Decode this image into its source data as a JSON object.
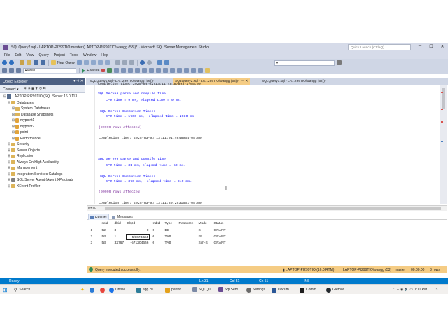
{
  "window": {
    "title": "SQLQuery2.sql - LAPTOP-PI299TIO.master (LAPTOP-PI299TIO\\wangg (53))* - Microsoft SQL Server Management Studio",
    "quick_launch_placeholder": "Quick Launch (Ctrl+Q)"
  },
  "menu": [
    "File",
    "Edit",
    "View",
    "Query",
    "Project",
    "Tools",
    "Window",
    "Help"
  ],
  "toolbar": {
    "new_query": "New Query",
    "database": "master",
    "execute": "Execute"
  },
  "object_explorer": {
    "title": "Object Explorer",
    "connect": "Connect ▾",
    "nodes": [
      {
        "label": "LAPTOP-PI299TIO (SQL Server 16.0.113",
        "indent": 0,
        "exp": "⊟",
        "kind": "server"
      },
      {
        "label": "Databases",
        "indent": 1,
        "exp": "⊟",
        "kind": "folder"
      },
      {
        "label": "System Databases",
        "indent": 2,
        "exp": "⊞",
        "kind": "folder"
      },
      {
        "label": "Database Snapshots",
        "indent": 2,
        "exp": "⊞",
        "kind": "folder"
      },
      {
        "label": "mypoint1",
        "indent": 2,
        "exp": "⊞",
        "kind": "db"
      },
      {
        "label": "mypoint2",
        "indent": 2,
        "exp": "⊞",
        "kind": "db"
      },
      {
        "label": "point",
        "indent": 2,
        "exp": "⊞",
        "kind": "db"
      },
      {
        "label": "Performance",
        "indent": 2,
        "exp": "⊞",
        "kind": "db"
      },
      {
        "label": "Security",
        "indent": 1,
        "exp": "⊞",
        "kind": "folder"
      },
      {
        "label": "Server Objects",
        "indent": 1,
        "exp": "⊞",
        "kind": "folder"
      },
      {
        "label": "Replication",
        "indent": 1,
        "exp": "⊞",
        "kind": "folder"
      },
      {
        "label": "Always On High Availability",
        "indent": 1,
        "exp": "⊞",
        "kind": "folder"
      },
      {
        "label": "Management",
        "indent": 1,
        "exp": "⊞",
        "kind": "folder"
      },
      {
        "label": "Integration Services Catalogs",
        "indent": 1,
        "exp": "⊞",
        "kind": "folder"
      },
      {
        "label": "SQL Server Agent (Agent XPs disabl",
        "indent": 1,
        "exp": "⊞",
        "kind": "agent"
      },
      {
        "label": "XEvent Profiler",
        "indent": 1,
        "exp": "⊞",
        "kind": "folder"
      }
    ]
  },
  "tabs": [
    {
      "label": "SQLQuery1.sql - LA...299TIO\\wangg (56))*",
      "active": false
    },
    {
      "label": "SQLQuery2.sql - LA...299TIO\\wangg (53))*",
      "active": true
    },
    {
      "label": "SQLQuery1.sql - LA...299TIO\\wangg (52))*",
      "active": false
    }
  ],
  "editor": {
    "line_top": "Completion time: 2025-03-02T13:11:48.8789371-05:00",
    "block1": {
      "parse": "SQL Server parse and compile time:",
      "cpu1": "CPU time = 9 ms, elapsed time = 9 ms.",
      "exec": "SQL Server Execution Times:",
      "cpu2": "CPU time = 1766 ms,  elapsed time = 2080 ms.",
      "rows": "(99999 rows affected)",
      "completion": "Completion time: 2025-03-02T13:11:01.4648064-05:00"
    },
    "block2": {
      "parse": "SQL Server parse and compile time:",
      "cpu1": "CPU time = 31 ms, elapsed time = 50 ms.",
      "exec": "SQL Server Execution Times:",
      "cpu2": "CPU time = 376 ms,  elapsed time = 249 ms.",
      "rows": "(99999 rows affected)",
      "completion": "Completion time: 2025-03-02T13:11:39.2531551-05:00"
    },
    "zoom": "97 %"
  },
  "results": {
    "tabs": [
      "Results",
      "Messages"
    ],
    "columns": [
      "spid",
      "dbid",
      "ObjId",
      "IndId",
      "Type",
      "Resource",
      "Mode",
      "Status"
    ],
    "rows": [
      [
        "1",
        "52",
        "3",
        "0",
        "0",
        "DB",
        "",
        "S",
        "GRANT"
      ],
      [
        "2",
        "53",
        "1",
        "5l9674324",
        "0",
        "TAB",
        "",
        "IS",
        "GRANT"
      ],
      [
        "3",
        "53",
        "32767",
        "-571204656",
        "0",
        "TAB",
        "",
        "Sch-S",
        "GRANT"
      ]
    ]
  },
  "query_status": {
    "message": "Query executed successfully.",
    "server": "LAPTOP-PI299TIO (16.0 RTM)",
    "user": "LAPTOP-PI299TIO\\wangg (53)",
    "db": "master",
    "elapsed": "00:00:00",
    "rows": "3 rows"
  },
  "app_status": {
    "ready": "Ready",
    "ln": "Ln 31",
    "col": "Col 51",
    "ch": "Ch 51",
    "ins": "INS"
  },
  "taskbar": {
    "search": "Search",
    "items": [
      "Untitle...",
      "app.cli...",
      "perfor...",
      "SQLQu...",
      "Sql Serv...",
      "Settings",
      "Docum...",
      "Comm...",
      "Giethos..."
    ],
    "time": "1:11 PM"
  },
  "colors": {
    "accent": "#007acc",
    "status_yellow": "#f5cc84",
    "oe_header": "#4d6082"
  }
}
